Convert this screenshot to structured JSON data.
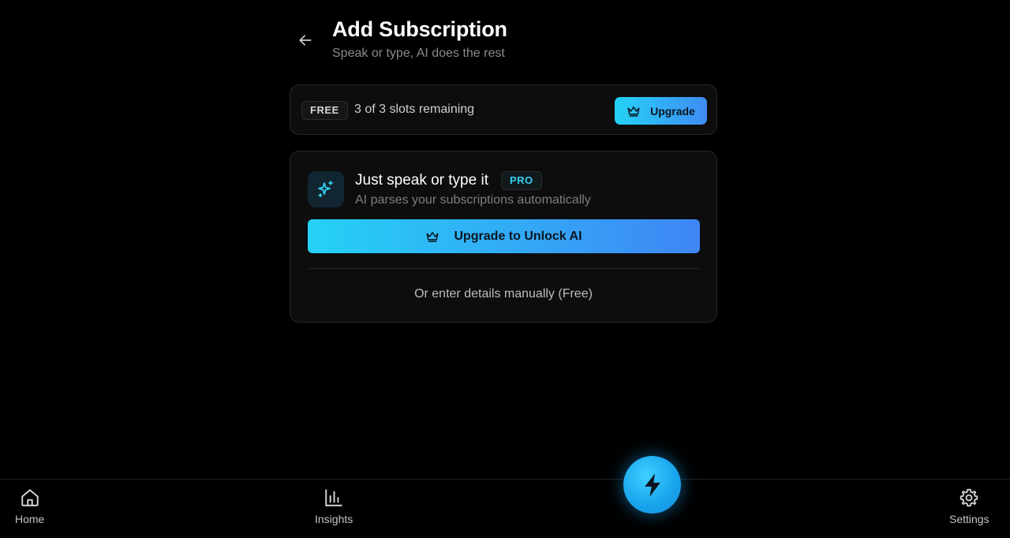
{
  "header": {
    "back_icon": "arrow-left-icon",
    "title": "Add Subscription",
    "subtitle": "Speak or type, AI does the rest"
  },
  "plan": {
    "badge": "FREE",
    "slots_text": "3 of 3 slots remaining",
    "upgrade_label": "Upgrade",
    "upgrade_icon": "crown-icon"
  },
  "ai_card": {
    "icon": "sparkles-icon",
    "heading": "Just speak or type it",
    "pro_badge": "PRO",
    "description": "AI parses your subscriptions automatically",
    "unlock_label": "Upgrade to Unlock AI",
    "unlock_icon": "crown-icon",
    "manual_link": "Or enter details manually (Free)"
  },
  "nav": {
    "items": [
      {
        "label": "Home",
        "icon": "home-icon"
      },
      {
        "label": "Insights",
        "icon": "bar-chart-icon"
      },
      {
        "label": "Settings",
        "icon": "gear-icon"
      }
    ],
    "fab_icon": "lightning-bolt-icon"
  },
  "colors": {
    "accent_start": "#25d2f5",
    "accent_end": "#3f86f5",
    "background": "#000000",
    "card": "#0d0d0d",
    "pro_text": "#33d0f0"
  }
}
